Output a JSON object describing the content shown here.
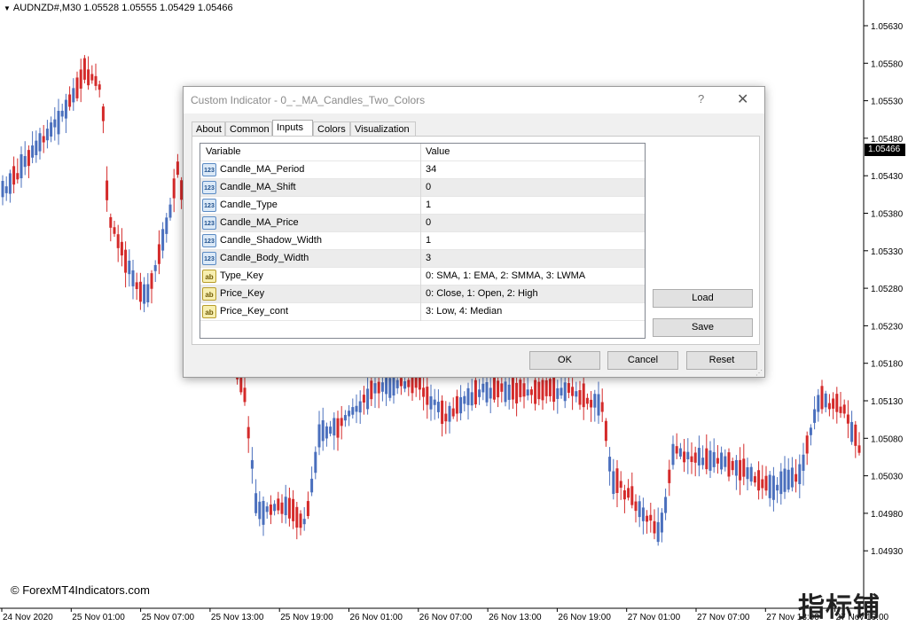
{
  "chart": {
    "symbol_info": "AUDNZD#,M30  1.05528 1.05555 1.05429 1.05466",
    "current_price": "1.05466",
    "price_ticks": [
      "1.05630",
      "1.05580",
      "1.05530",
      "1.05480",
      "1.05430",
      "1.05380",
      "1.05330",
      "1.05280",
      "1.05230",
      "1.05180",
      "1.05130",
      "1.05080",
      "1.05030",
      "1.04980",
      "1.04930"
    ],
    "time_ticks": [
      "24 Nov 2020",
      "25 Nov 01:00",
      "25 Nov 07:00",
      "25 Nov 13:00",
      "25 Nov 19:00",
      "26 Nov 01:00",
      "26 Nov 07:00",
      "26 Nov 13:00",
      "26 Nov 19:00",
      "27 Nov 01:00",
      "27 Nov 07:00",
      "27 Nov 13:00",
      "27 Nov 19:00"
    ],
    "bull_color": "#4a6fbd",
    "bear_color": "#d42a2a",
    "watermark": "© ForexMT4Indicators.com",
    "corner_mark": "指标铺"
  },
  "dialog": {
    "title": "Custom Indicator - 0_-_MA_Candles_Two_Colors",
    "help_glyph": "?",
    "close_glyph": "✕",
    "tabs": [
      {
        "label": "About",
        "active": false
      },
      {
        "label": "Common",
        "active": false
      },
      {
        "label": "Inputs",
        "active": true
      },
      {
        "label": "Colors",
        "active": false
      },
      {
        "label": "Visualization",
        "active": false
      }
    ],
    "grid": {
      "col_variable": "Variable",
      "col_value": "Value",
      "rows": [
        {
          "type": "num",
          "variable": "Candle_MA_Period",
          "value": "34"
        },
        {
          "type": "num",
          "variable": "Candle_MA_Shift",
          "value": "0"
        },
        {
          "type": "num",
          "variable": "Candle_Type",
          "value": "1"
        },
        {
          "type": "num",
          "variable": "Candle_MA_Price",
          "value": "0"
        },
        {
          "type": "num",
          "variable": "Candle_Shadow_Width",
          "value": "1"
        },
        {
          "type": "num",
          "variable": "Candle_Body_Width",
          "value": "3"
        },
        {
          "type": "str",
          "variable": "Type_Key",
          "value": "0: SMA, 1: EMA, 2: SMMA, 3: LWMA"
        },
        {
          "type": "str",
          "variable": "Price_Key",
          "value": "0: Close, 1: Open, 2: High"
        },
        {
          "type": "str",
          "variable": "Price_Key_cont",
          "value": " 3: Low, 4: Median"
        }
      ]
    },
    "icons": {
      "num": "123",
      "str": "ab"
    },
    "buttons": {
      "load": "Load",
      "save": "Save",
      "ok": "OK",
      "cancel": "Cancel",
      "reset": "Reset"
    }
  }
}
